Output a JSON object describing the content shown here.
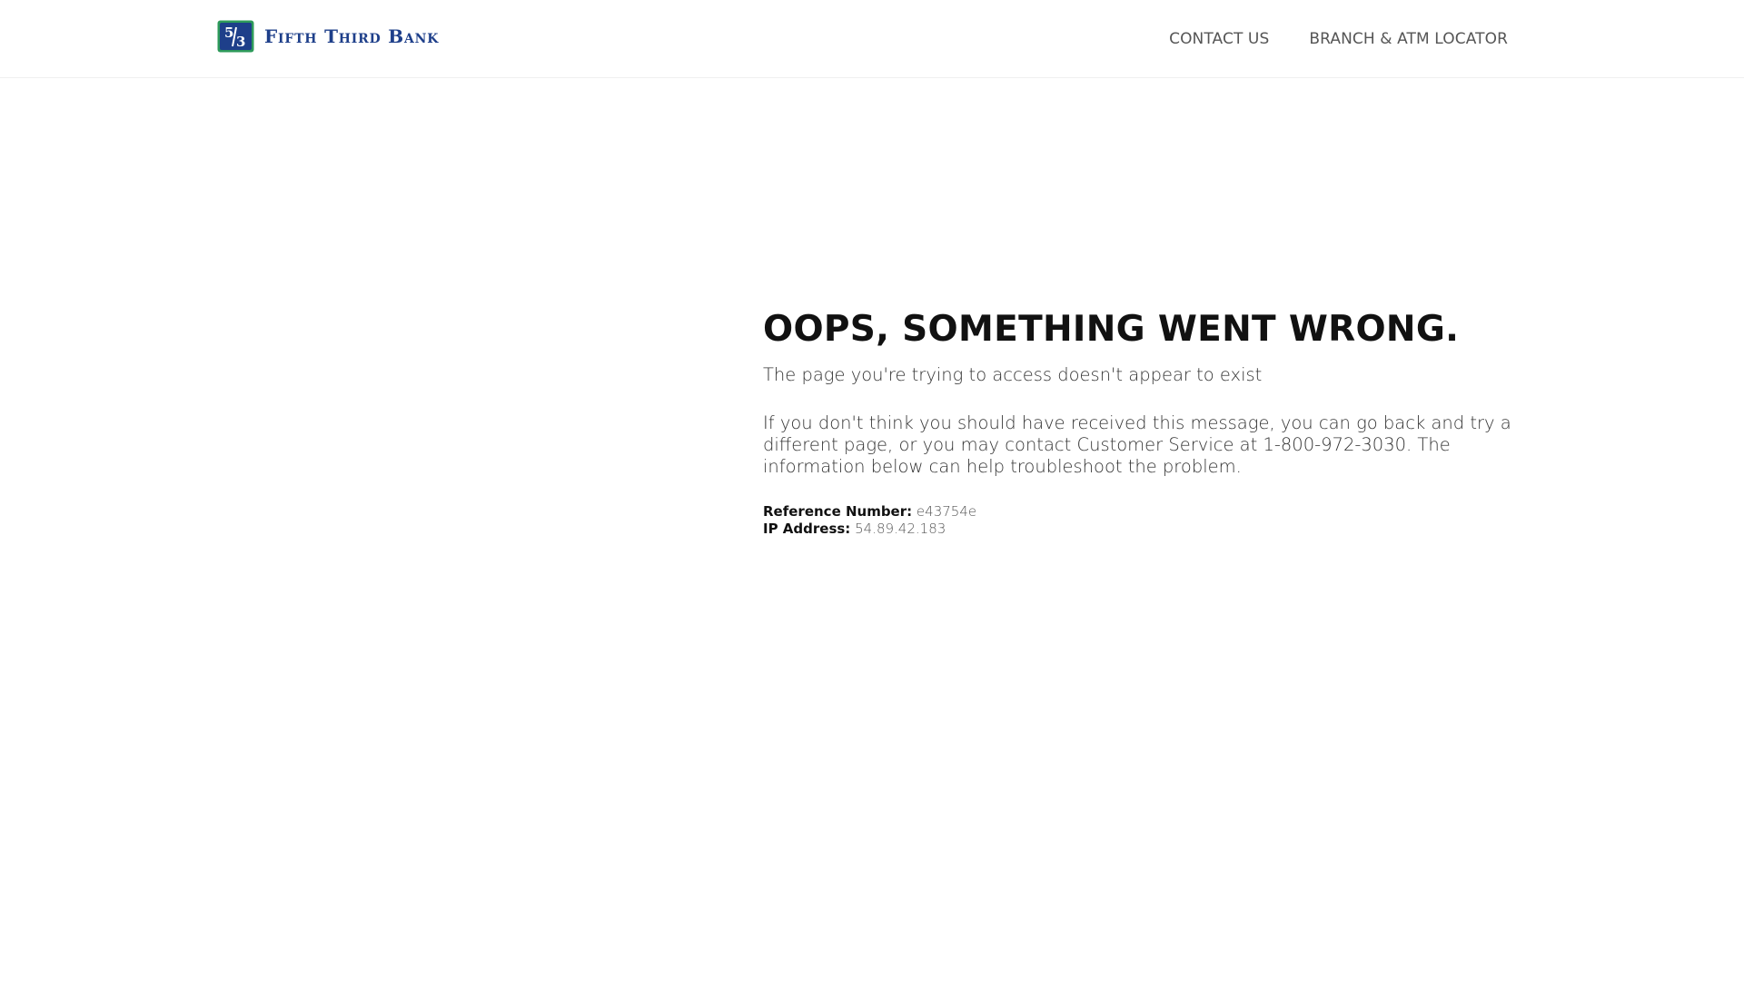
{
  "header": {
    "logo_text": "Fifth Third Bank",
    "brand_colors": {
      "primary_blue": "#1e3f8a",
      "accent_green": "#2d9a5a"
    },
    "nav": [
      {
        "label": "CONTACT US"
      },
      {
        "label": "BRANCH & ATM LOCATOR"
      }
    ]
  },
  "error": {
    "title": "OOPS, SOMETHING WENT WRONG.",
    "subtitle": "The page you're trying to access doesn't appear to exist",
    "message": "If you don't think you should have received this message, you can go back and try a different page, or you may contact Customer Service at 1-800-972-3030. The information below can help troubleshoot the problem.",
    "reference_label": "Reference Number:",
    "reference_value": "e43754e",
    "ip_label": "IP Address:",
    "ip_value": "54.89.42.183"
  }
}
